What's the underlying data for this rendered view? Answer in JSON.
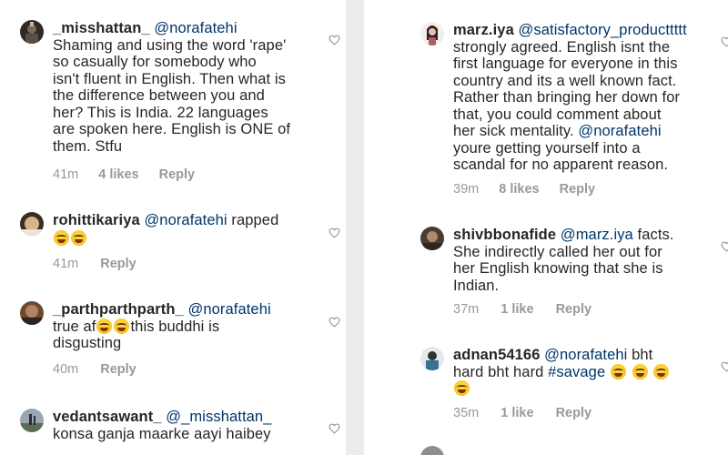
{
  "left": {
    "comments": [
      {
        "username": "_misshattan_",
        "mention": "@norafatehi",
        "lines": [
          "Shaming and using the word 'rape'",
          "so casually for somebody who",
          "isn't fluent in English. Then what is",
          "the difference between you and",
          "her? This is India. 22 languages",
          "are spoken here. English is ONE of",
          "them. Stfu"
        ],
        "time": "41m",
        "likes": "4 likes",
        "reply": "Reply"
      },
      {
        "username": "rohittikariya",
        "mention": "@norafatehi",
        "text_after": "rapped",
        "time": "41m",
        "reply": "Reply"
      },
      {
        "username": "_parthparthparth_",
        "mention": "@norafatehi",
        "line2_a": "true af",
        "line2_b": "this buddhi is",
        "line3": "disgusting",
        "time": "40m",
        "reply": "Reply"
      },
      {
        "username": "vedantsawant_",
        "mention": "@_misshattan_",
        "line2": "konsa ganja maarke aayi haibey"
      }
    ]
  },
  "right": {
    "comments": [
      {
        "username": "marz.iya",
        "mention": "@satisfactory_producttttt",
        "lines_before": [
          "strongly agreed. English isnt the",
          "first language for everyone in this",
          "country and its a well known fact.",
          "Rather than bringing her down for",
          "that, you could comment about",
          "her sick mentality."
        ],
        "inline_mention": "@norafatehi",
        "lines_after": [
          "youre getting yourself into a",
          "scandal for no apparent reason."
        ],
        "time": "39m",
        "likes": "8 likes",
        "reply": "Reply"
      },
      {
        "username": "shivbbonafide",
        "mention": "@marz.iya",
        "text_after": "facts.",
        "lines": [
          "She indirectly called her out for",
          "her English knowing that she is",
          "Indian."
        ],
        "time": "37m",
        "likes": "1 like",
        "reply": "Reply"
      },
      {
        "username": "adnan54166",
        "mention": "@norafatehi",
        "text_after": "bht",
        "line2": "hard bht hard",
        "hashtag": "#savage",
        "time": "35m",
        "likes": "1 like",
        "reply": "Reply"
      }
    ]
  },
  "icons": {
    "like": "heart-outline-icon"
  }
}
